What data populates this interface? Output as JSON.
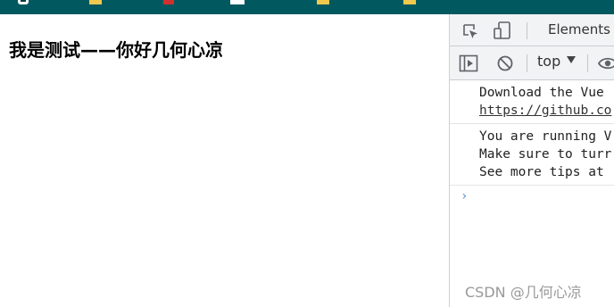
{
  "page": {
    "heading": "我是测试——你好几何心凉"
  },
  "devtools": {
    "tabs": {
      "elements_label": "Elements"
    },
    "toolbar": {
      "context_value": "top"
    },
    "console": {
      "messages": [
        {
          "line1": "Download the Vue",
          "link": "https://github.co"
        },
        {
          "line1": "You are running V",
          "line2": "Make sure to turr",
          "line3": "See more tips at"
        }
      ],
      "prompt_symbol": "›"
    }
  },
  "watermark": {
    "text": "CSDN @几何心凉"
  },
  "colors": {
    "bookmarks_bar": "#01585f",
    "devtools_bg": "#f1f3f4",
    "link": "#333333",
    "prompt": "#5b8dd6"
  }
}
